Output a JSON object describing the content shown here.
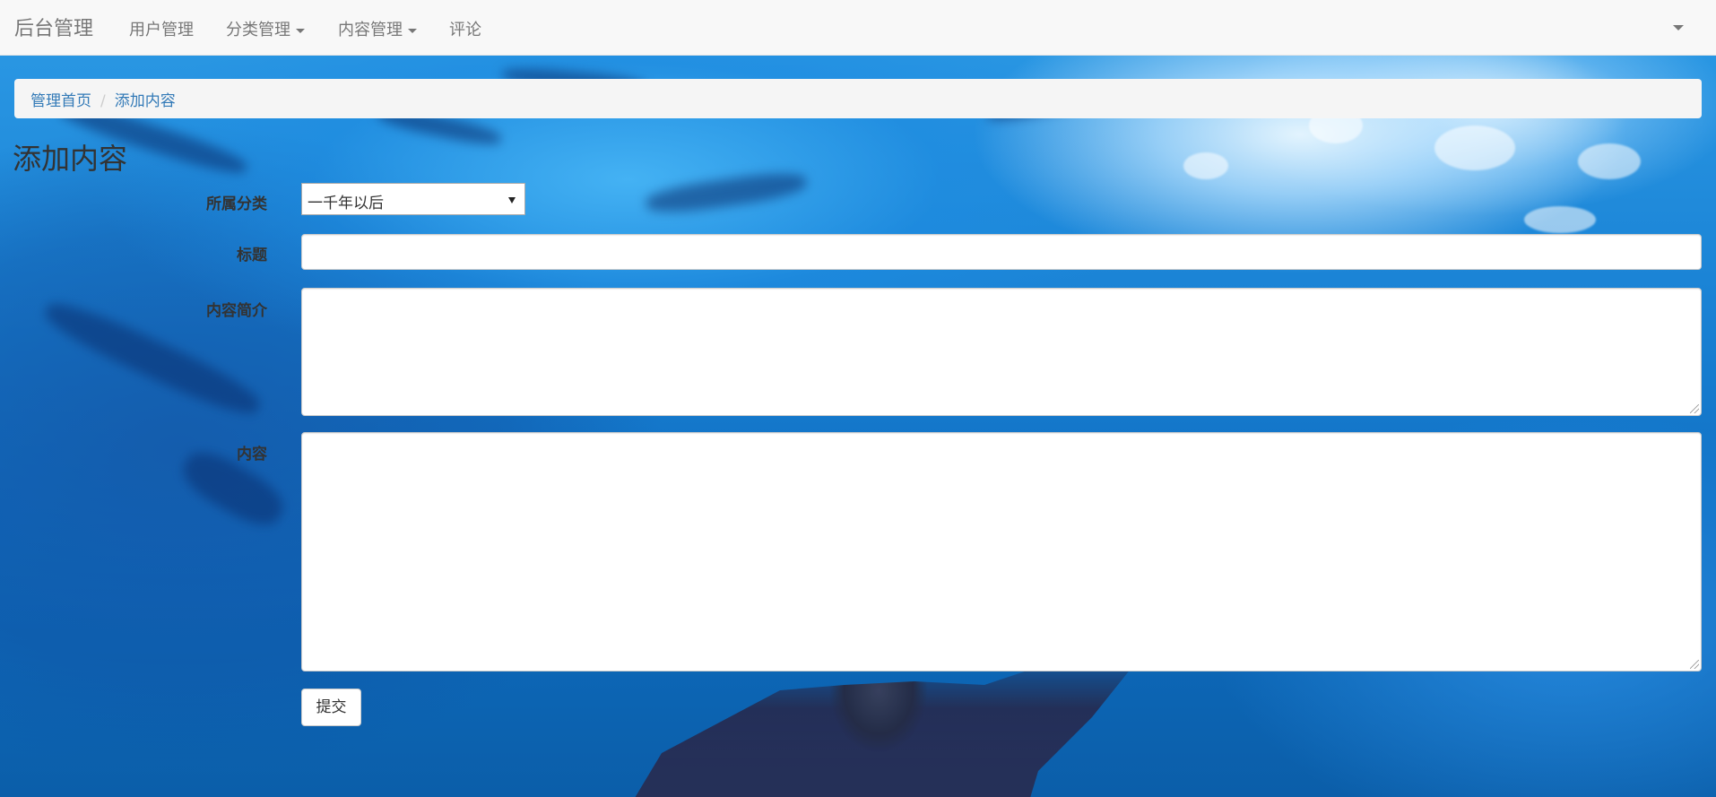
{
  "navbar": {
    "brand": "后台管理",
    "items": [
      {
        "label": "用户管理",
        "dropdown": false
      },
      {
        "label": "分类管理",
        "dropdown": true
      },
      {
        "label": "内容管理",
        "dropdown": true
      },
      {
        "label": "评论",
        "dropdown": false
      }
    ]
  },
  "breadcrumb": {
    "items": [
      "管理首页",
      "添加内容"
    ],
    "separator": "/"
  },
  "page": {
    "title": "添加内容"
  },
  "form": {
    "category": {
      "label": "所属分类",
      "selected": "一千年以后"
    },
    "title": {
      "label": "标题",
      "value": ""
    },
    "summary": {
      "label": "内容简介",
      "value": ""
    },
    "content": {
      "label": "内容",
      "value": ""
    },
    "submit_label": "提交"
  },
  "colors": {
    "navbar_bg": "#f8f8f8",
    "link": "#337ab7",
    "text": "#333333",
    "nav_text": "#777777"
  }
}
